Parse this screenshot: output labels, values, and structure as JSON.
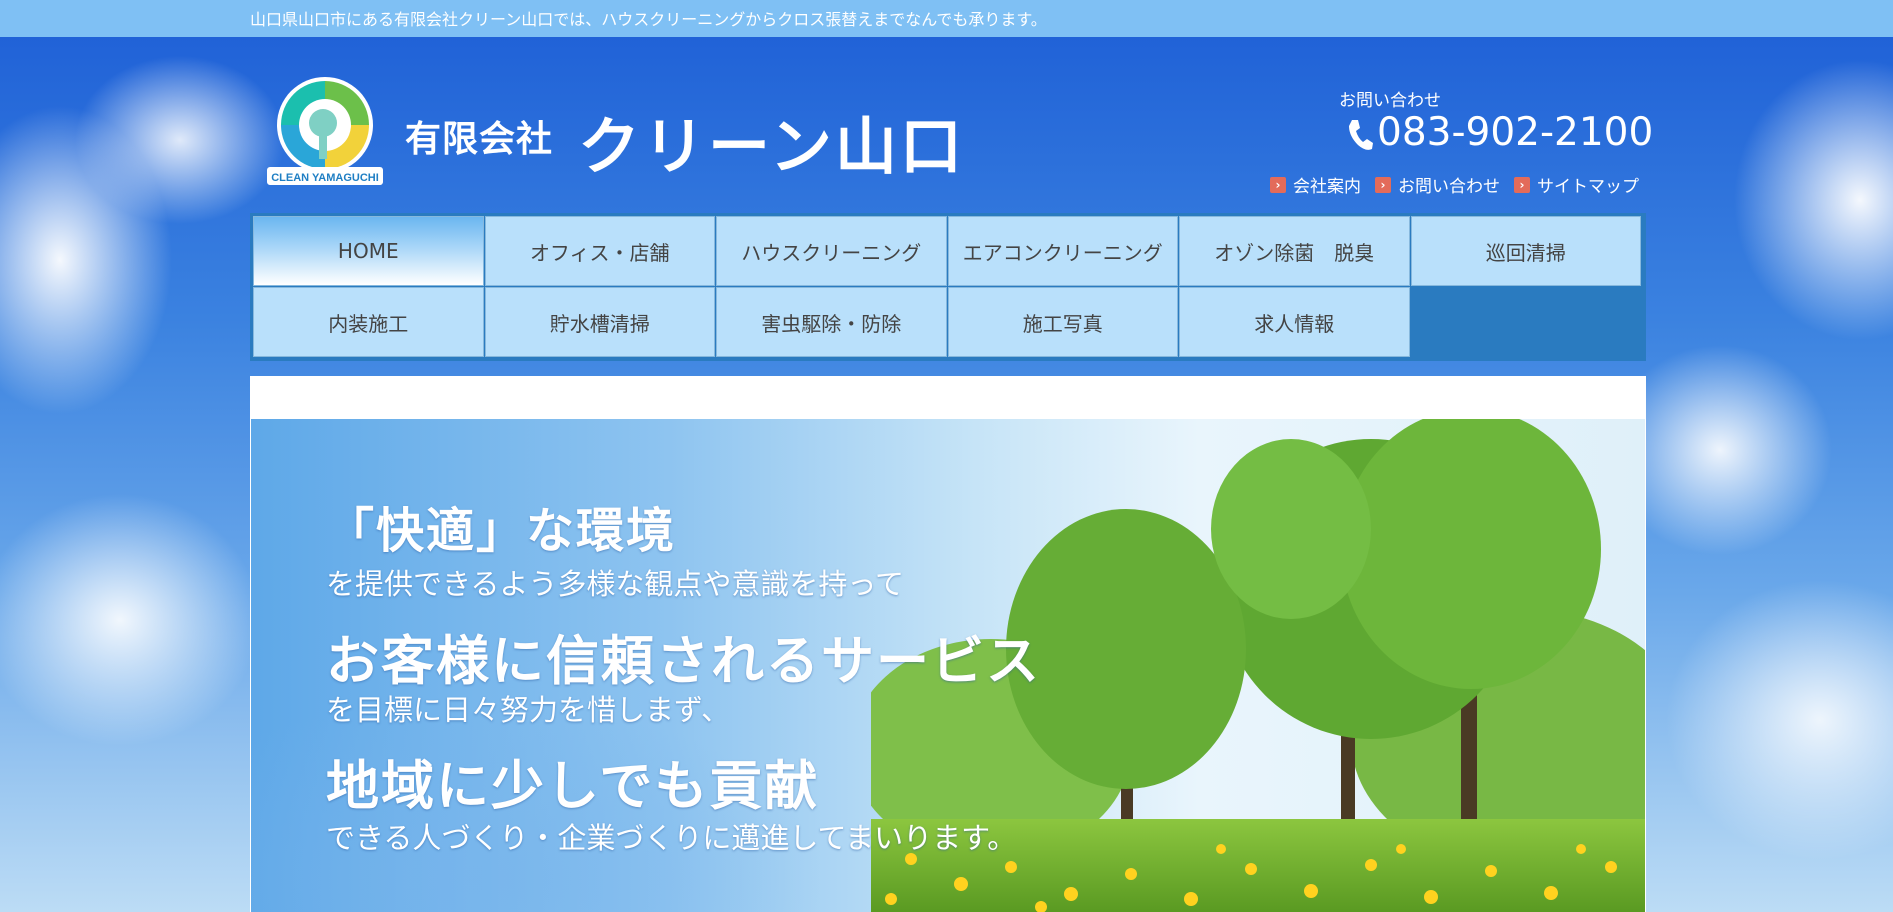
{
  "topbar": {
    "text": "山口県山口市にある有限会社クリーン山口では、ハウスクリーニングからクロス張替えまでなんでも承ります。"
  },
  "header": {
    "logo_caption": "CLEAN YAMAGUCHI",
    "company_prefix": "有限会社",
    "company_name": "クリーン山口",
    "contact_label": "お問い合わせ",
    "phone": "083-902-2100",
    "links": [
      {
        "label": "会社案内",
        "icon": "arrow-right-icon"
      },
      {
        "label": "お問い合わせ",
        "icon": "arrow-right-icon"
      },
      {
        "label": "サイトマップ",
        "icon": "arrow-right-icon"
      }
    ]
  },
  "nav": {
    "items": [
      {
        "label": "HOME",
        "active": true
      },
      {
        "label": "オフィス・店舗"
      },
      {
        "label": "ハウスクリーニング"
      },
      {
        "label": "エアコンクリーニング"
      },
      {
        "label": "オゾン除菌　脱臭"
      },
      {
        "label": "巡回清掃"
      },
      {
        "label": "内装施工"
      },
      {
        "label": "貯水槽清掃"
      },
      {
        "label": "害虫駆除・防除"
      },
      {
        "label": "施工写真"
      },
      {
        "label": "求人情報"
      }
    ]
  },
  "hero": {
    "line1": "「快適」な環境",
    "line2": "を提供できるよう多様な観点や意識を持って",
    "line3": "お客様に信頼されるサービス",
    "line4": "を目標に日々努力を惜しまず、",
    "line5": "地域に少しでも貢献",
    "line6": "できる人づくり・企業づくりに邁進してまいります。"
  },
  "colors": {
    "topbar": "#7fc0f4",
    "nav_cell": "#b9e0fb",
    "nav_frame": "#2a7bc0",
    "link_arrow": "#e36b5a"
  }
}
